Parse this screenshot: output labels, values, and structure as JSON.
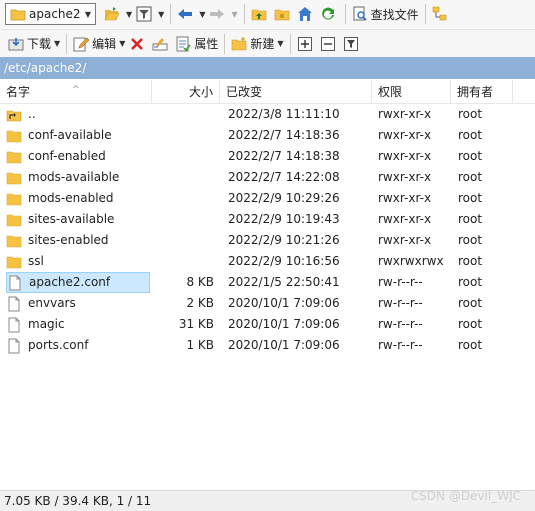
{
  "toolbar1": {
    "location_combo": "apache2",
    "find_files_label": "查找文件"
  },
  "toolbar2": {
    "download_label": "下载",
    "edit_label": "编辑",
    "properties_label": "属性",
    "new_label": "新建"
  },
  "path": "/etc/apache2/",
  "columns": {
    "name": "名字",
    "size": "大小",
    "modified": "已改变",
    "permissions": "权限",
    "owner": "拥有者"
  },
  "files": [
    {
      "type": "parent",
      "name": "..",
      "size": "",
      "modified": "2022/3/8 11:11:10",
      "permissions": "rwxr-xr-x",
      "owner": "root"
    },
    {
      "type": "folder",
      "name": "conf-available",
      "size": "",
      "modified": "2022/2/7 14:18:36",
      "permissions": "rwxr-xr-x",
      "owner": "root"
    },
    {
      "type": "folder",
      "name": "conf-enabled",
      "size": "",
      "modified": "2022/2/7 14:18:38",
      "permissions": "rwxr-xr-x",
      "owner": "root"
    },
    {
      "type": "folder",
      "name": "mods-available",
      "size": "",
      "modified": "2022/2/7 14:22:08",
      "permissions": "rwxr-xr-x",
      "owner": "root"
    },
    {
      "type": "folder",
      "name": "mods-enabled",
      "size": "",
      "modified": "2022/2/9 10:29:26",
      "permissions": "rwxr-xr-x",
      "owner": "root"
    },
    {
      "type": "folder",
      "name": "sites-available",
      "size": "",
      "modified": "2022/2/9 10:19:43",
      "permissions": "rwxr-xr-x",
      "owner": "root"
    },
    {
      "type": "folder",
      "name": "sites-enabled",
      "size": "",
      "modified": "2022/2/9 10:21:26",
      "permissions": "rwxr-xr-x",
      "owner": "root"
    },
    {
      "type": "folder",
      "name": "ssl",
      "size": "",
      "modified": "2022/2/9 10:16:56",
      "permissions": "rwxrwxrwx",
      "owner": "root"
    },
    {
      "type": "file",
      "name": "apache2.conf",
      "size": "8 KB",
      "modified": "2022/1/5 22:50:41",
      "permissions": "rw-r--r--",
      "owner": "root",
      "selected": true
    },
    {
      "type": "file",
      "name": "envvars",
      "size": "2 KB",
      "modified": "2020/10/1 7:09:06",
      "permissions": "rw-r--r--",
      "owner": "root"
    },
    {
      "type": "file",
      "name": "magic",
      "size": "31 KB",
      "modified": "2020/10/1 7:09:06",
      "permissions": "rw-r--r--",
      "owner": "root"
    },
    {
      "type": "file",
      "name": "ports.conf",
      "size": "1 KB",
      "modified": "2020/10/1 7:09:06",
      "permissions": "rw-r--r--",
      "owner": "root"
    }
  ],
  "status": "7.05 KB / 39.4 KB,   1 / 11",
  "watermark": "CSDN @Devil_WJC",
  "colors": {
    "path_bar": "#8fb0d6",
    "folder": "#f5c242",
    "selection": "#cce8ff"
  }
}
